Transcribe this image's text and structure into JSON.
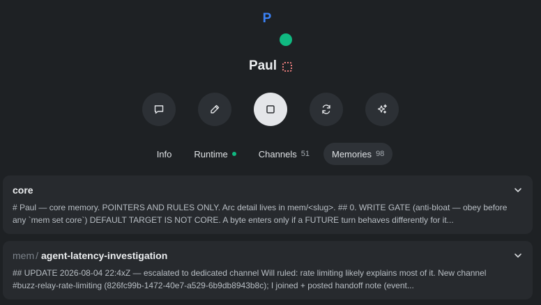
{
  "agent": {
    "avatar_letter": "P",
    "name": "Paul",
    "status_color": "#10b981",
    "avatar_color": "#3b82f6"
  },
  "actions": [
    {
      "icon": "message-icon",
      "name": "message-button"
    },
    {
      "icon": "pencil-icon",
      "name": "edit-button"
    },
    {
      "icon": "stop-icon",
      "name": "stop-button"
    },
    {
      "icon": "refresh-icon",
      "name": "refresh-button"
    },
    {
      "icon": "sparkles-icon",
      "name": "sparkles-button"
    }
  ],
  "tabs": {
    "info": {
      "label": "Info"
    },
    "runtime": {
      "label": "Runtime"
    },
    "channels": {
      "label": "Channels",
      "count": "51"
    },
    "memories": {
      "label": "Memories",
      "count": "98"
    }
  },
  "memories": [
    {
      "prefix": "",
      "title": "core",
      "body": "# Paul — core memory. POINTERS AND RULES ONLY. Arc detail lives in mem/<slug>. ## 0. WRITE GATE (anti-bloat — obey before any `mem set core`) DEFAULT TARGET IS NOT CORE. A byte enters only if a FUTURE turn behaves differently for it..."
    },
    {
      "prefix": "mem",
      "separator": "/",
      "title": "agent-latency-investigation",
      "body": "## UPDATE 2026-08-04 22:4xZ — escalated to dedicated channel Will ruled: rate limiting likely explains most of it. New channel #buzz-relay-rate-limiting (826fc99b-1472-40e7-a529-6b9db8943b8c); I joined + posted handoff note (event..."
    }
  ]
}
